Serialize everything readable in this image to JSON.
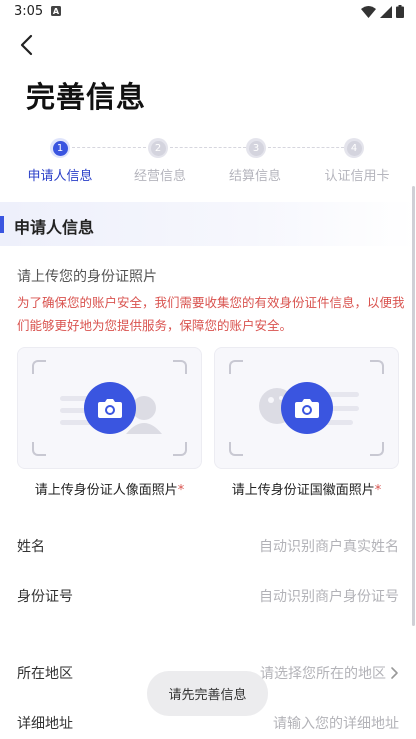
{
  "status_bar": {
    "time": "3:05"
  },
  "page": {
    "title": "完善信息"
  },
  "stepper": {
    "steps": [
      {
        "num": "1",
        "label": "申请人信息",
        "active": true
      },
      {
        "num": "2",
        "label": "经营信息",
        "active": false
      },
      {
        "num": "3",
        "label": "结算信息",
        "active": false
      },
      {
        "num": "4",
        "label": "认证信用卡",
        "active": false
      }
    ]
  },
  "section": {
    "title": "申请人信息"
  },
  "upload": {
    "hint": "请上传您的身份证照片",
    "warning": "为了确保您的账户安全，我们需要收集您的有效身份证件信息，以便我们能够更好地为您提供服务，保障您的账户安全。",
    "front_caption": "请上传身份证人像面照片",
    "back_caption": "请上传身份证国徽面照片",
    "required_mark": "*"
  },
  "form": {
    "name": {
      "label": "姓名",
      "placeholder": "自动识别商户真实姓名"
    },
    "id_number": {
      "label": "身份证号",
      "placeholder": "自动识别商户身份证号"
    },
    "region": {
      "label": "所在地区",
      "placeholder": "请选择您所在的地区"
    },
    "address": {
      "label": "详细地址",
      "placeholder": "请输入您的详细地址"
    }
  },
  "toast": {
    "text": "请先完善信息"
  },
  "colors": {
    "accent": "#3a55e0",
    "warning": "#d9534f"
  },
  "icons": [
    "back-arrow-icon",
    "camera-icon",
    "wifi-icon",
    "signal-icon",
    "battery-icon",
    "chevron-right-icon"
  ]
}
